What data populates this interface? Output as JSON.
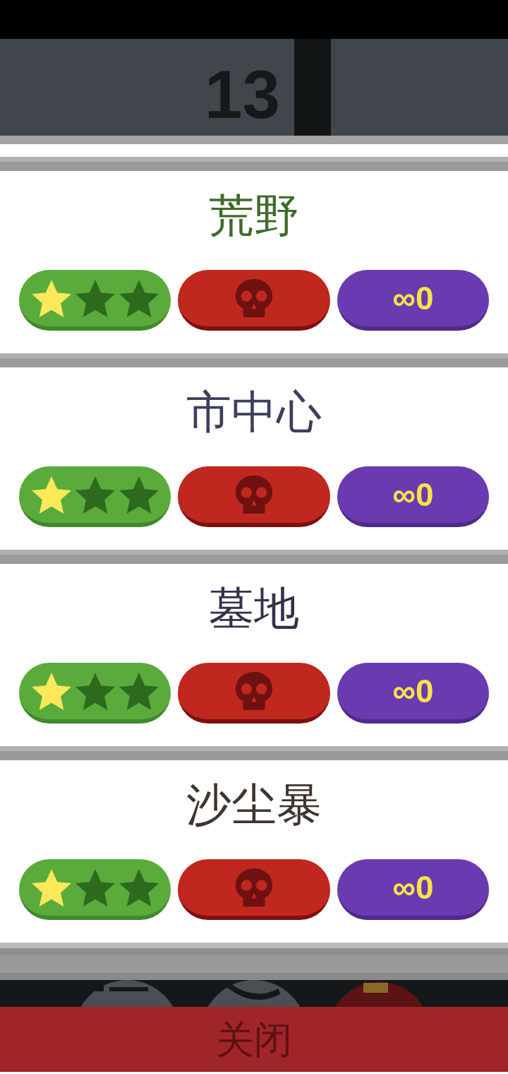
{
  "header": {
    "text": "13"
  },
  "levels": [
    {
      "name": "荒野",
      "color": "#3f6b2c",
      "stars": 1,
      "record": "∞0"
    },
    {
      "name": "市中心",
      "color": "#3c3f5c",
      "stars": 1,
      "record": "∞0"
    },
    {
      "name": "墓地",
      "color": "#34304a",
      "stars": 1,
      "record": "∞0"
    },
    {
      "name": "沙尘暴",
      "color": "#40342f",
      "stars": 1,
      "record": "∞0"
    }
  ],
  "close_button": {
    "label": "关闭"
  }
}
